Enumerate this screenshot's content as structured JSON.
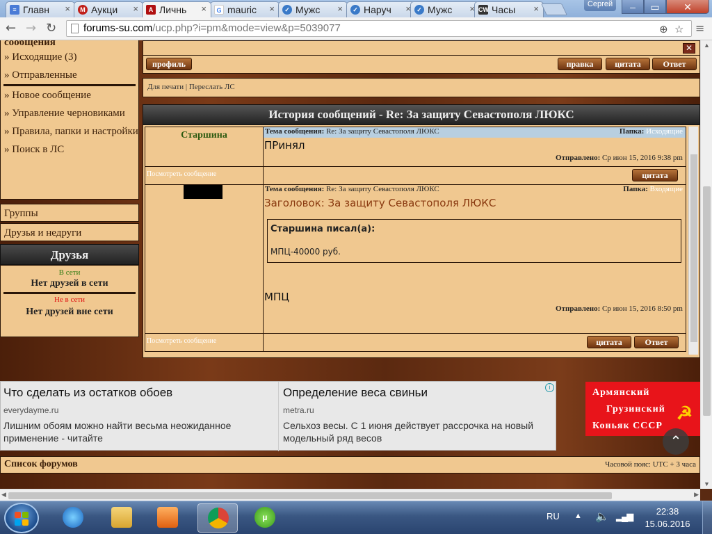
{
  "browser": {
    "tabs": [
      {
        "label": "Главн",
        "icon": "docs-icon",
        "color": "#4a7bd6"
      },
      {
        "label": "Аукци",
        "icon": "auction-icon",
        "color": "#c0201a"
      },
      {
        "label": "Личнь",
        "icon": "forum-icon",
        "color": "#b01010"
      },
      {
        "label": "mauric",
        "icon": "google-icon",
        "color": "#ffffff"
      },
      {
        "label": "Мужс",
        "icon": "watch-icon",
        "color": "#3a7ac8"
      },
      {
        "label": "Наруч",
        "icon": "watch-icon",
        "color": "#3a7ac8"
      },
      {
        "label": "Мужс",
        "icon": "watch-icon",
        "color": "#3a7ac8"
      },
      {
        "label": "Часы",
        "icon": "cw-icon",
        "color": "#333333"
      }
    ],
    "user": "Сергей",
    "url_domain": "forums-su.com",
    "url_path": "/ucp.php?i=pm&mode=view&p=5039077"
  },
  "sidebar": {
    "top_cut": "сообщения",
    "items1": [
      "» Исходящие (3)",
      "» Отправленные"
    ],
    "items2": [
      "» Новое сообщение",
      "» Управление черновиками",
      "» Правила, папки и настройки",
      "» Поиск в ЛС"
    ],
    "groups": "Группы",
    "friends_foes": "Друзья и недруги",
    "friends_header": "Друзья",
    "online_label": "В сети",
    "online_text": "Нет друзей в сети",
    "offline_label": "Не в сети",
    "offline_text": "Нет друзей вне сети"
  },
  "toolbar": {
    "profile": "профиль",
    "help": "правка",
    "quote": "цитата",
    "reply": "Ответ",
    "print": "Для печати",
    "forward": "Переслать ЛС"
  },
  "history": {
    "title": "История сообщений - Re: За защиту Севастополя ЛЮКС",
    "messages": [
      {
        "author": "Старшина",
        "subject_label": "Тема сообщения:",
        "subject": "Re: За защиту Севастополя ЛЮКС",
        "folder_label": "Папка:",
        "folder": "Исходящие",
        "body": "ПРинял",
        "sent_label": "Отправлено:",
        "sent": "Ср июн 15, 2016 9:38 pm",
        "view_link": "Посмотреть сообщение",
        "quote_btn": "цитата"
      },
      {
        "author": "",
        "subject_label": "Тема сообщения:",
        "subject": "Re: За защиту Севастополя ЛЮКС",
        "folder_label": "Папка:",
        "folder": "Входящие",
        "heading": "Заголовок: За защиту Севастополя ЛЮКС",
        "quote_author": "Старшина писал(а):",
        "quote_text": "МПЦ-40000 руб.",
        "body": "МПЦ",
        "sent_label": "Отправлено:",
        "sent": "Ср июн 15, 2016 8:50 pm",
        "view_link": "Посмотреть сообщение",
        "quote_btn": "цитата",
        "reply_btn": "Ответ"
      }
    ]
  },
  "ads": [
    {
      "title": "Что сделать из остатков обоев",
      "source": "everydayme.ru",
      "desc": "Лишним обоям можно найти весьма неожиданное применение - читайте"
    },
    {
      "title": "Определение веса свиньи",
      "source": "metra.ru",
      "desc": "Сельхоз весы. С 1 июня действует рассрочка на новый модельный ряд весов"
    }
  ],
  "banner": {
    "line1": "Армянский",
    "line2": "Грузинский",
    "line3": "Коньяк СССР"
  },
  "footer": {
    "forums_list": "Список форумов",
    "timezone": "Часовой пояс: UTC + 3 часа"
  },
  "taskbar": {
    "lang": "RU",
    "time": "22:38",
    "date": "15.06.2016"
  }
}
